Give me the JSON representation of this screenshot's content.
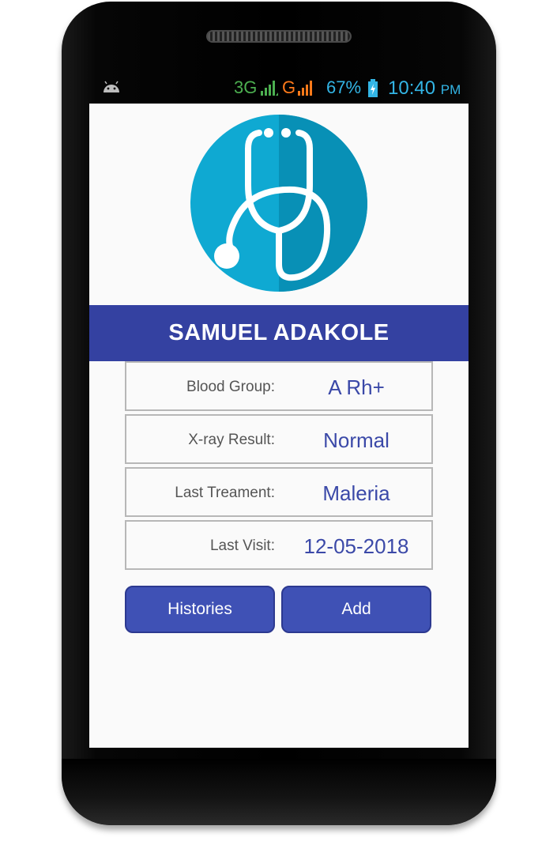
{
  "status_bar": {
    "network_3g": "3G",
    "network_g": "G",
    "battery_percent": "67%",
    "time": "10:40",
    "time_suffix": "PM",
    "icons": [
      "android-icon",
      "signal-icon",
      "signal-icon",
      "battery-charging-icon"
    ]
  },
  "profile": {
    "name": "SAMUEL ADAKOLE",
    "logo_icon": "stethoscope-icon"
  },
  "info_rows": [
    {
      "label": "Blood Group:",
      "value": "A Rh+"
    },
    {
      "label": "X-ray Result:",
      "value": "Normal"
    },
    {
      "label": "Last Treament:",
      "value": "Maleria"
    },
    {
      "label": "Last Visit:",
      "value": "12-05-2018"
    }
  ],
  "buttons": {
    "histories": "Histories",
    "add": "Add"
  },
  "colors": {
    "primary": "#3441a1",
    "button": "#3f51b5",
    "value_text": "#3b49a8",
    "logo_light": "#0fa9d2",
    "logo_dark": "#0890b6"
  }
}
